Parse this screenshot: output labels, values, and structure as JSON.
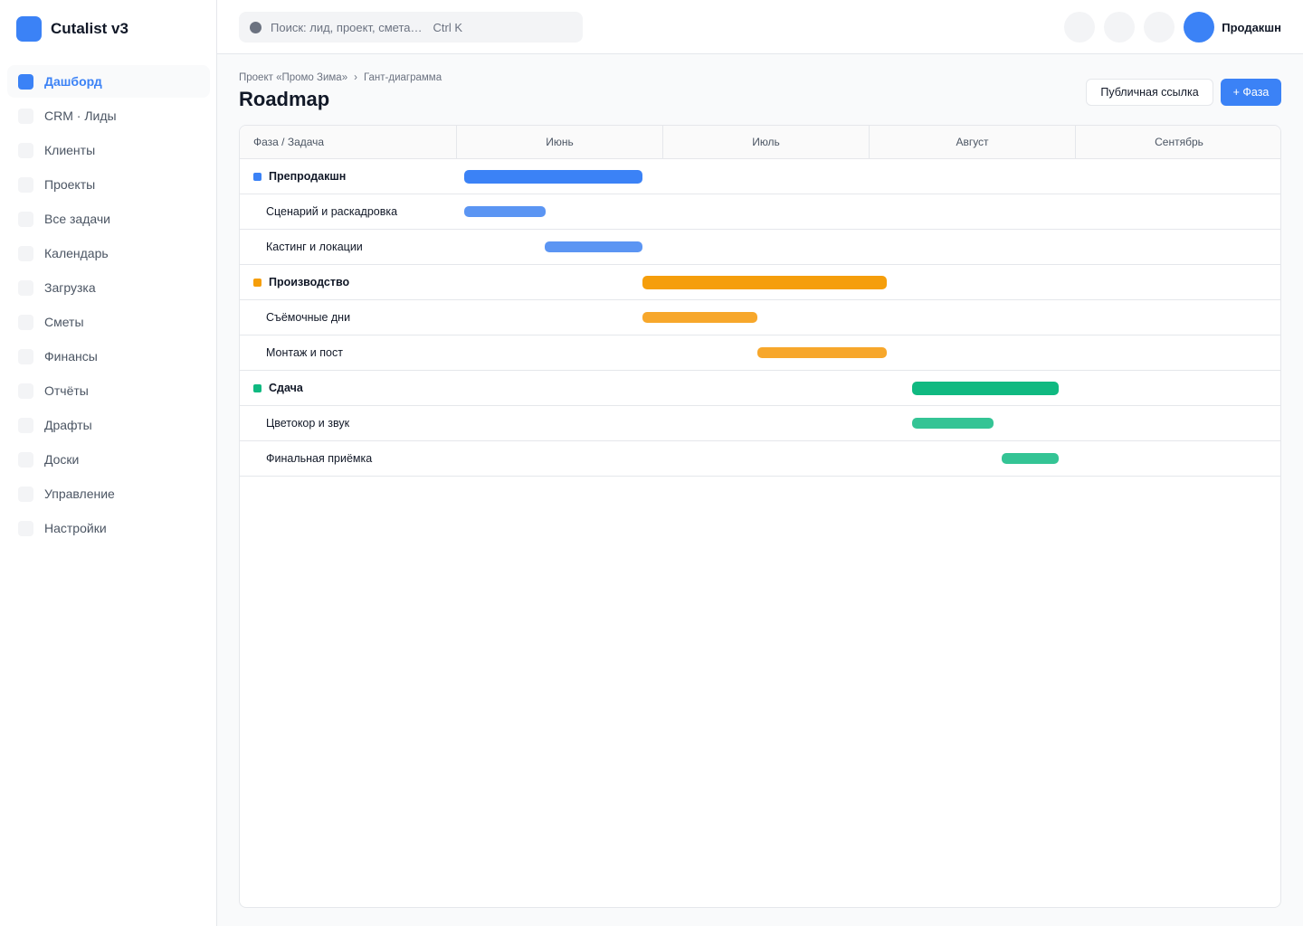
{
  "app": {
    "name": "Cutalist v3"
  },
  "sidebar": {
    "items": [
      {
        "label": "Дашборд",
        "active": true
      },
      {
        "label": "CRM · Лиды"
      },
      {
        "label": "Клиенты"
      },
      {
        "label": "Проекты"
      },
      {
        "label": "Все задачи"
      },
      {
        "label": "Календарь"
      },
      {
        "label": "Загрузка"
      },
      {
        "label": "Сметы"
      },
      {
        "label": "Финансы"
      },
      {
        "label": "Отчёты"
      },
      {
        "label": "Драфты"
      },
      {
        "label": "Доски"
      },
      {
        "label": "Управление"
      },
      {
        "label": "Настройки"
      }
    ]
  },
  "topbar": {
    "search_placeholder": "Поиск: лид, проект, смета…",
    "search_shortcut": "Ctrl K",
    "workspace_name": "Продакшн"
  },
  "breadcrumb": {
    "project": "Проект «Промо Зима»",
    "separator": "›",
    "current": "Гант-диаграмма"
  },
  "page": {
    "title": "Roadmap",
    "public_link_label": "Публичная ссылка",
    "add_phase_label": "+ Фаза"
  },
  "gantt": {
    "task_column_label": "Фаза / Задача",
    "months": [
      "Июнь",
      "Июль",
      "Август",
      "Сентябрь"
    ],
    "rows": [
      {
        "kind": "phase",
        "label": "Препродакшн",
        "color": "#3b82f6",
        "start": 0.035,
        "end": 0.9
      },
      {
        "kind": "task",
        "label": "Сценарий и раскадровка",
        "color": "#5b95f3",
        "start": 0.035,
        "end": 0.43
      },
      {
        "kind": "task",
        "label": "Кастинг и локации",
        "color": "#5b95f3",
        "start": 0.425,
        "end": 0.9
      },
      {
        "kind": "phase",
        "label": "Производство",
        "color": "#f59e0b",
        "start": 0.9,
        "end": 2.085
      },
      {
        "kind": "task",
        "label": "Съёмочные дни",
        "color": "#f7a72b",
        "start": 0.9,
        "end": 1.455
      },
      {
        "kind": "task",
        "label": "Монтаж и пост",
        "color": "#f7a72b",
        "start": 1.455,
        "end": 2.085
      },
      {
        "kind": "phase",
        "label": "Сдача",
        "color": "#10b981",
        "start": 2.205,
        "end": 2.915
      },
      {
        "kind": "task",
        "label": "Цветокор и звук",
        "color": "#34c495",
        "start": 2.205,
        "end": 2.6
      },
      {
        "kind": "task",
        "label": "Финальная приёмка",
        "color": "#34c495",
        "start": 2.64,
        "end": 2.915
      }
    ]
  }
}
